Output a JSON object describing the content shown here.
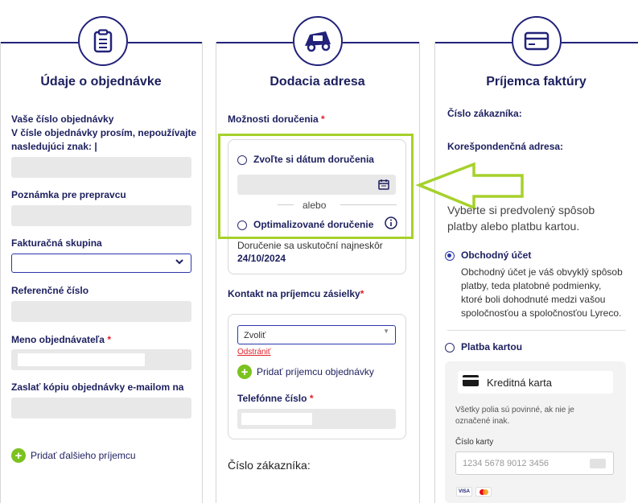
{
  "col1": {
    "title": "Údaje o objednávke",
    "order_number_label_1": "Vaše číslo objednávky",
    "order_number_label_2": "V čísle objednávky prosím, nepoužívajte",
    "order_number_label_3": "nasledujúci znak: |",
    "note_label": "Poznámka pre prepravcu",
    "billing_group_label": "Fakturačná skupina",
    "reference_label": "Referenčné číslo",
    "orderer_name_label": "Meno objednávateľa",
    "required_mark": "*",
    "email_copy_label": "Zaslať kópiu objednávky e-mailom na",
    "add_recipient": "Pridať ďalšieho príjemcu"
  },
  "col2": {
    "title": "Dodacia adresa",
    "delivery_options_label": "Možnosti doručenia",
    "required_mark": "*",
    "choose_date": "Zvoľte si dátum doručenia",
    "or": "alebo",
    "optimized": "Optimalizované doručenie",
    "delivery_note": "Doručenie sa uskutoční najneskôr",
    "delivery_date": "24/10/2024",
    "contact_label": "Kontakt na príjemcu zásielky",
    "select_value": "Zvoliť",
    "remove": "Odstrániť",
    "add_contact": "Pridať príjemcu objednávky",
    "phone_label": "Telefónne číslo",
    "customer_no": "Číslo zákazníka:"
  },
  "col3": {
    "title": "Príjemca faktúry",
    "customer_no": "Číslo zákazníka:",
    "address_label": "Korešpondenčná adresa:",
    "choose_payment_1": "Vyberte si predvolený spôsob",
    "choose_payment_2": "platby alebo platbu kartou.",
    "account": "Obchodný účet",
    "account_desc_1": "Obchodný účet je váš obvyklý spôsob",
    "account_desc_2": "platby, teda platobné podmienky,",
    "account_desc_3": "ktoré boli dohodnuté medzi vašou",
    "account_desc_4": "spoločnosťou a spoločnosťou Lyreco.",
    "card_payment": "Platba kartou",
    "credit_card": "Kreditná karta",
    "mandatory_1": "Všetky polia sú povinné, ak nie je",
    "mandatory_2": "označené inak.",
    "card_number_label": "Číslo karty",
    "card_placeholder": "1234 5678 9012 3456",
    "visa": "VISA"
  },
  "colors": {
    "navy": "#1c1f5e",
    "line": "#22227a",
    "green": "#a6d12b",
    "plus_green": "#7bc21f",
    "red": "#e0212b"
  }
}
